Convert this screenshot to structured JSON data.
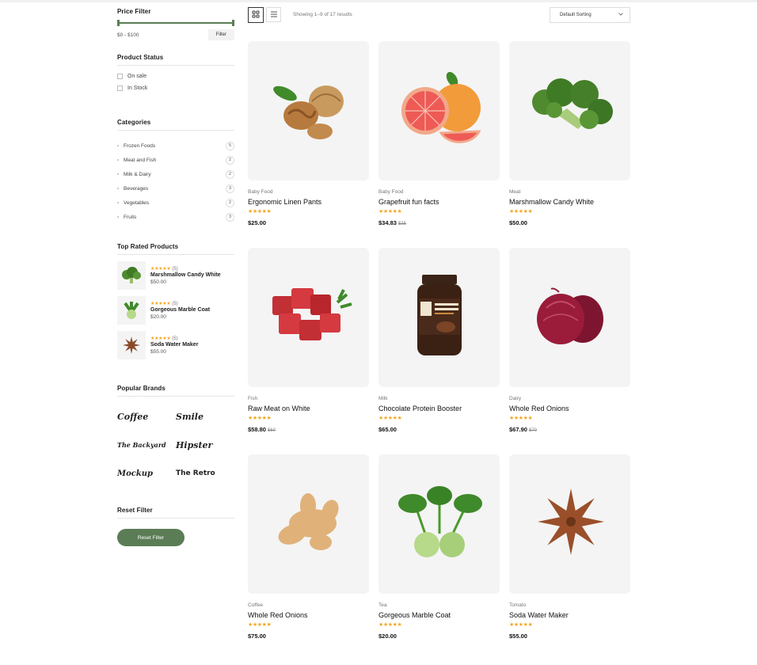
{
  "sidebar": {
    "price_filter": {
      "title": "Price Filter",
      "range": "$0 - $100",
      "button": "Filter"
    },
    "product_status": {
      "title": "Product Status",
      "items": [
        "On sale",
        "In Stock"
      ]
    },
    "categories": {
      "title": "Categories",
      "items": [
        {
          "name": "Frozen Foods",
          "count": "5"
        },
        {
          "name": "Meat and Fish",
          "count": "2"
        },
        {
          "name": "Milk & Dairy",
          "count": "2"
        },
        {
          "name": "Beverages",
          "count": "3"
        },
        {
          "name": "Vegetables",
          "count": "2"
        },
        {
          "name": "Fruits",
          "count": "3"
        }
      ]
    },
    "top_rated": {
      "title": "Top Rated Products",
      "items": [
        {
          "stars": "★★★★★",
          "count": "(5)",
          "name": "Marshmallow Candy White",
          "price": "$50.00",
          "icon": "broccoli-icon"
        },
        {
          "stars": "★★★★★",
          "count": "(5)",
          "name": "Gorgeous Marble Coat",
          "price": "$20.00",
          "icon": "kohlrabi-icon"
        },
        {
          "stars": "★★★★★",
          "count": "(5)",
          "name": "Soda Water Maker",
          "price": "$55.00",
          "icon": "star-anise-icon"
        }
      ]
    },
    "brands": {
      "title": "Popular Brands",
      "items": [
        "Coffee",
        "Smile",
        "The Backyard",
        "Hipster",
        "Mockup",
        "The Retro"
      ]
    },
    "reset": {
      "title": "Reset Filter",
      "button": "Reset Filter"
    }
  },
  "toolbar": {
    "grid_icon": "grid-view-icon",
    "list_icon": "list-view-icon",
    "result_count": "Showing 1–9 of 17 results",
    "sort": "Default Sorting"
  },
  "products": [
    {
      "category": "Baby Food",
      "name": "Ergonomic Linen Pants",
      "stars": "★★★★★",
      "price": "$25.00",
      "old_price": "",
      "icon": "walnut-icon"
    },
    {
      "category": "Baby Food",
      "name": "Grapefruit fun facts",
      "stars": "★★★★★",
      "price": "$34.83",
      "old_price": "$35",
      "icon": "grapefruit-icon"
    },
    {
      "category": "Meat",
      "name": "Marshmallow Candy White",
      "stars": "★★★★★",
      "price": "$50.00",
      "old_price": "",
      "icon": "broccoli-icon"
    },
    {
      "category": "Fish",
      "name": "Raw Meat on White",
      "stars": "★★★★★",
      "price": "$58.80",
      "old_price": "$60",
      "icon": "raw-meat-icon"
    },
    {
      "category": "Milk",
      "name": "Chocolate Protein Booster",
      "stars": "★★★★★",
      "price": "$65.00",
      "old_price": "",
      "icon": "peanut-butter-jar-icon"
    },
    {
      "category": "Dairy",
      "name": "Whole Red Onions",
      "stars": "★★★★★",
      "price": "$67.90",
      "old_price": "$70",
      "icon": "red-onion-icon"
    },
    {
      "category": "Coffee",
      "name": "Whole Red Onions",
      "stars": "★★★★★",
      "price": "$75.00",
      "old_price": "",
      "icon": "ginger-icon"
    },
    {
      "category": "Tea",
      "name": "Gorgeous Marble Coat",
      "stars": "★★★★★",
      "price": "$20.00",
      "old_price": "",
      "icon": "kohlrabi-icon"
    },
    {
      "category": "Tomato",
      "name": "Soda Water Maker",
      "stars": "★★★★★",
      "price": "$55.00",
      "old_price": "",
      "icon": "star-anise-icon"
    }
  ],
  "colors": {
    "accent": "#5b7d55",
    "star": "#f5a623",
    "card_bg": "#f4f4f4"
  }
}
